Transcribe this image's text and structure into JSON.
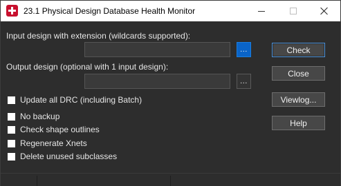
{
  "window": {
    "title": "23.1 Physical Design Database Health Monitor",
    "icon": "allegro-app-icon"
  },
  "titlebar": {
    "minimize_icon": "minimize-icon",
    "maximize_icon": "maximize-icon",
    "close_icon": "close-icon"
  },
  "input_design": {
    "label": "Input design with extension (wildcards supported):",
    "value": "",
    "browse_label": "..."
  },
  "output_design": {
    "label": "Output design (optional with 1 input design):",
    "value": "",
    "browse_label": "..."
  },
  "options": [
    {
      "label": "Update all DRC (including Batch)",
      "checked": false
    },
    {
      "label": "No backup",
      "checked": false
    },
    {
      "label": "Check shape outlines",
      "checked": false
    },
    {
      "label": "Regenerate Xnets",
      "checked": false
    },
    {
      "label": "Delete unused subclasses",
      "checked": false
    }
  ],
  "buttons": {
    "check": "Check",
    "close": "Close",
    "viewlog": "Viewlog...",
    "help": "Help"
  },
  "colors": {
    "background": "#2d2d2d",
    "accent": "#0a64c8",
    "app_icon": "#c8102e"
  }
}
